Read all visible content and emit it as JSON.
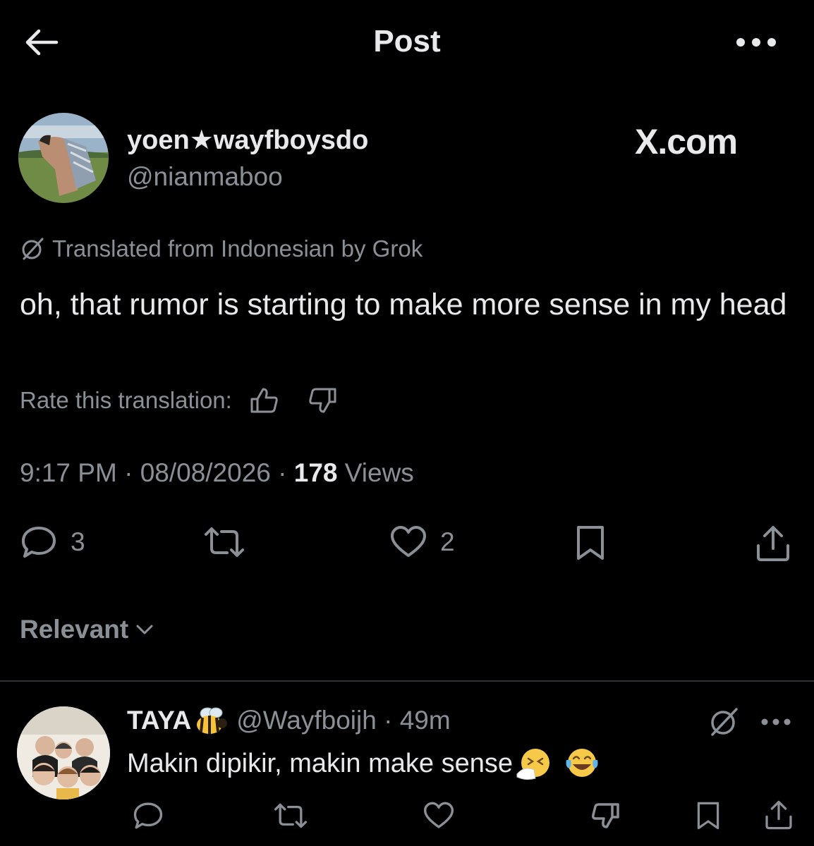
{
  "header": {
    "title": "Post",
    "back_icon": "arrow-left-icon",
    "more_icon": "more-horizontal-icon"
  },
  "author": {
    "display_name": "yoen★wayfboysdo",
    "handle": "@nianmaboo",
    "watermark": "X.com"
  },
  "translation": {
    "note": "Translated from Indonesian by Grok",
    "text": "oh, that rumor is starting to make more sense in my head",
    "rate_label": "Rate this translation:"
  },
  "meta": {
    "time": "9:17 PM",
    "date": "08/08/2026",
    "views_count": "178",
    "views_label": "Views"
  },
  "actions": {
    "replies": "3",
    "likes": "2"
  },
  "sort": {
    "label": "Relevant"
  },
  "reply": {
    "name": "TAYA",
    "handle_time": "@Wayfboijh · 49m",
    "text": "Makin dipikir, makin make sense"
  },
  "colors": {
    "background": "#000000",
    "text": "#e7e9ea",
    "muted": "#8b9097",
    "divider": "#2f3336"
  }
}
